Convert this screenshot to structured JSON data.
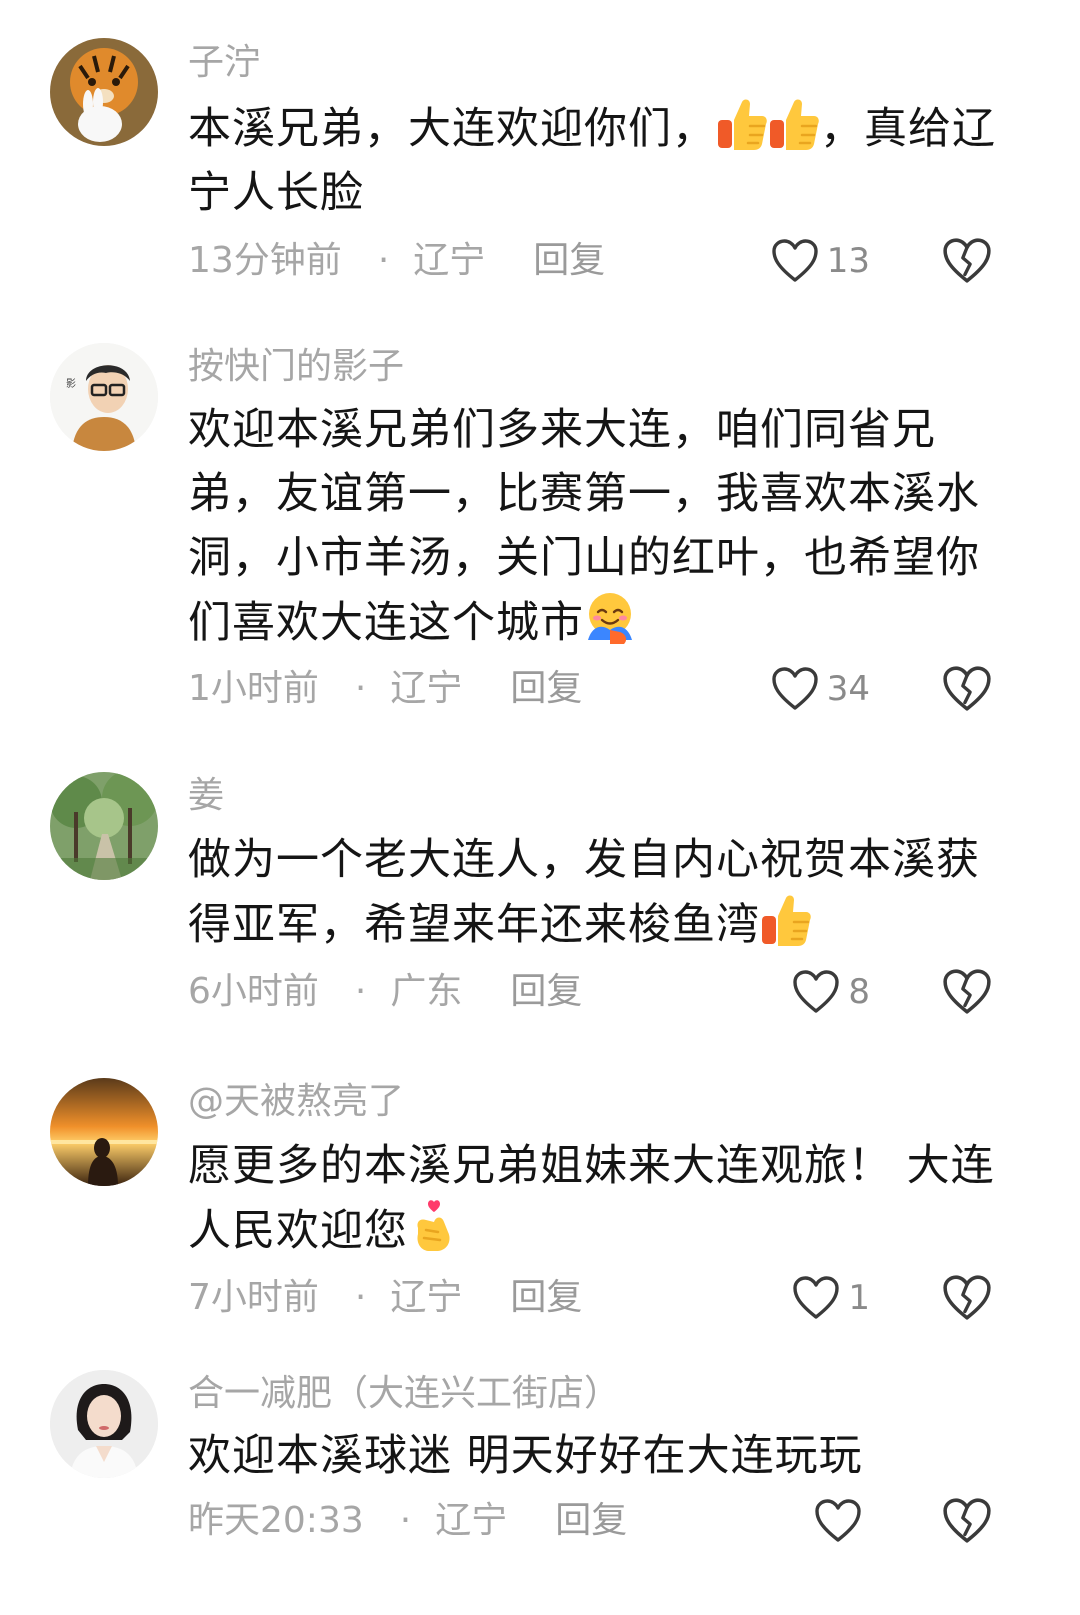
{
  "comments": [
    {
      "username": "子泞",
      "text": "本溪兄弟，大连欢迎你们，",
      "text_after": "，真给辽宁人长脸",
      "emojis": [
        "thumbs-up-icon",
        "thumbs-up-icon"
      ],
      "time": "13分钟前",
      "location": "辽宁",
      "reply": "回复",
      "likes": "13",
      "avatar": "tiger-with-rabbit-avatar"
    },
    {
      "username": "按快门的影子",
      "text": "欢迎本溪兄弟们多来大连，咱们同省兄弟，友谊第一，比赛第一，我喜欢本溪水洞，小市羊汤，关门山的红叶，也希望你们喜欢大连这个城市",
      "emojis": [
        "hug-icon"
      ],
      "time": "1小时前",
      "location": "辽宁",
      "reply": "回复",
      "likes": "34",
      "avatar": "cartoon-man-glasses-avatar"
    },
    {
      "username": "姜",
      "text": "做为一个老大连人，发自内心祝贺本溪获得亚军，希望来年还来梭鱼湾",
      "emojis": [
        "thumbs-up-icon"
      ],
      "time": "6小时前",
      "location": "广东",
      "reply": "回复",
      "likes": "8",
      "avatar": "forest-path-avatar"
    },
    {
      "username": "@天被熬亮了",
      "text": "愿更多的本溪兄弟姐妹来大连观旅！ 大连人民欢迎您",
      "emojis": [
        "finger-heart-icon"
      ],
      "time": "7小时前",
      "location": "辽宁",
      "reply": "回复",
      "likes": "1",
      "avatar": "sunset-silhouette-avatar"
    },
    {
      "username": "合一减肥（大连兴工街店）",
      "text": "欢迎本溪球迷  明天好好在大连玩玩",
      "emojis": [],
      "time": "昨天20:33",
      "location": "辽宁",
      "reply": "回复",
      "likes": "",
      "avatar": "woman-portrait-avatar"
    }
  ],
  "colors": {
    "text": "#151515",
    "meta": "#a6a6a6",
    "thumb_yellow": "#ffc83d",
    "thumb_red": "#f05a28",
    "heart_pink": "#ff3b6b"
  }
}
